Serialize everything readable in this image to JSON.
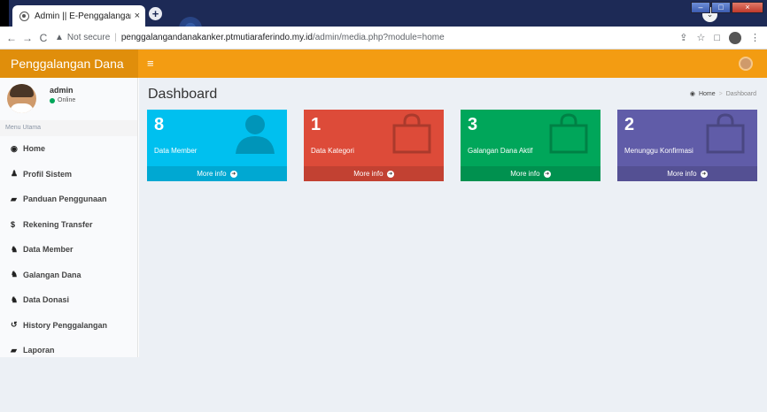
{
  "browser": {
    "tab_title": "Admin || E-Penggalangan Dana",
    "tab_close": "×",
    "new_tab": "+",
    "not_secure": "Not secure",
    "url_host": "penggalangandanakanker.ptmutiaraferindo.my.id",
    "url_path": "/admin/media.php?module=home"
  },
  "header": {
    "logo": "Penggalangan Dana",
    "toggle": "≡"
  },
  "user": {
    "name": "admin",
    "status": "Online",
    "status_color": "#00a65a"
  },
  "sidebar": {
    "menu_header": "Menu Utama",
    "items": [
      {
        "label": "Home",
        "icon": "dashboard-icon"
      },
      {
        "label": "Profil Sistem",
        "icon": "user-icon"
      },
      {
        "label": "Panduan Penggunaan",
        "icon": "book-icon"
      },
      {
        "label": "Rekening Transfer",
        "icon": "dollar-icon"
      },
      {
        "label": "Data Member",
        "icon": "users-icon"
      },
      {
        "label": "Galangan Dana",
        "icon": "users-icon"
      },
      {
        "label": "Data Donasi",
        "icon": "users-icon"
      },
      {
        "label": "History Penggalangan",
        "icon": "history-icon"
      },
      {
        "label": "Laporan",
        "icon": "book-icon"
      }
    ]
  },
  "content": {
    "title": "Dashboard",
    "breadcrumb": {
      "home": "Home",
      "current": "Dashboard"
    }
  },
  "boxes": [
    {
      "count": "8",
      "label": "Data Member",
      "more": "More info",
      "color": "#00c0ef",
      "icon": "person-icon"
    },
    {
      "count": "1",
      "label": "Data Kategori",
      "more": "More info",
      "color": "#dd4b39",
      "icon": "shopping-bag-icon"
    },
    {
      "count": "3",
      "label": "Galangan Dana Aktif",
      "more": "More info",
      "color": "#00a65a",
      "icon": "shopping-bag-icon"
    },
    {
      "count": "2",
      "label": "Menunggu Konfirmasi",
      "more": "More info",
      "color": "#605ca8",
      "icon": "shopping-bag-icon"
    }
  ],
  "colors": {
    "header": "#f39c12",
    "logo_bg": "#e08e0b",
    "content_bg": "#ecf0f5"
  }
}
